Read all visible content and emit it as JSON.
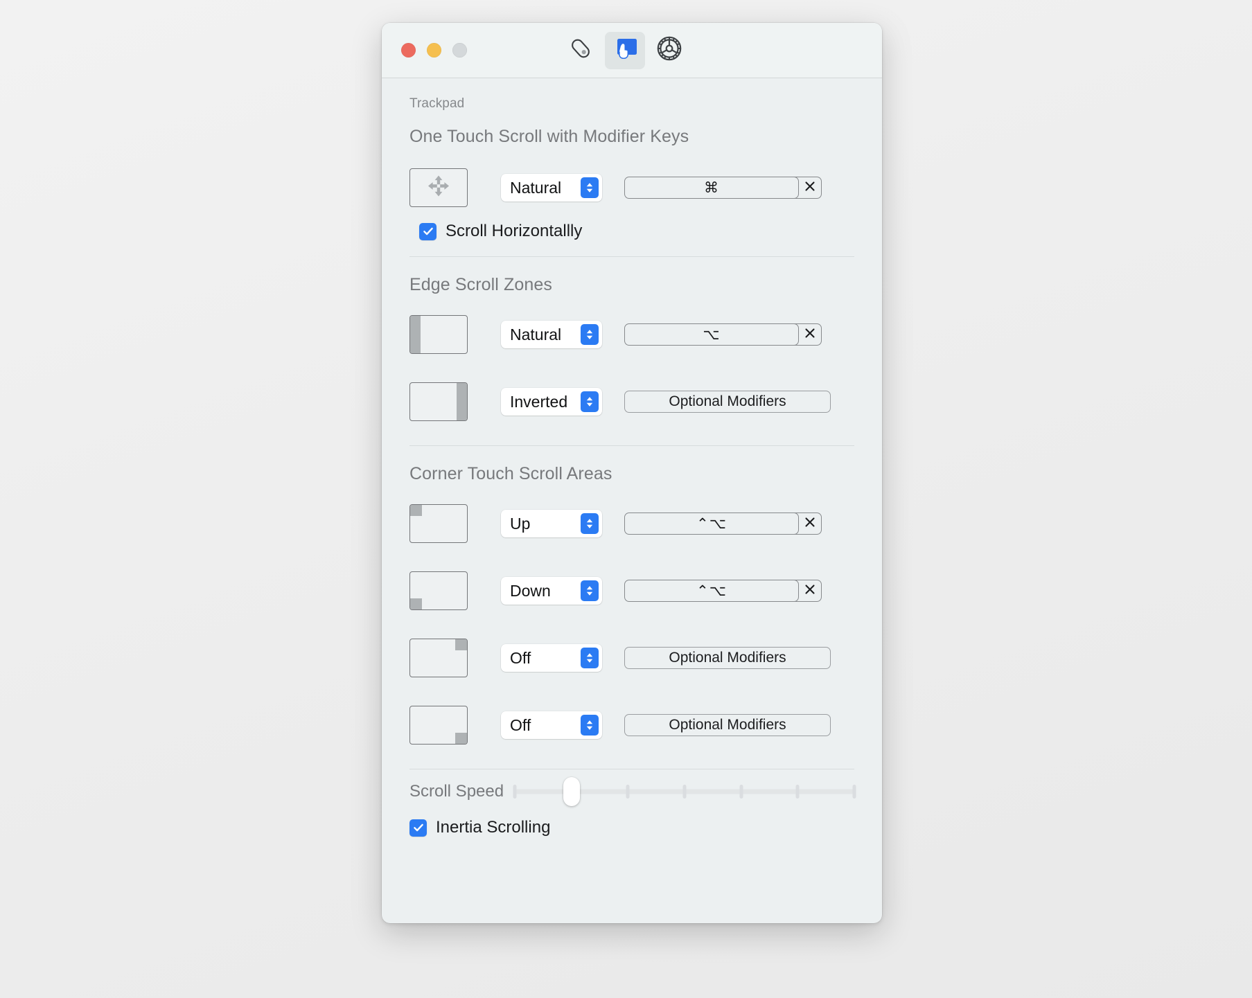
{
  "window": {
    "traffic_lights": [
      {
        "name": "close",
        "color": "#ec6a5e"
      },
      {
        "name": "minimize",
        "color": "#f5bf4f"
      },
      {
        "name": "zoom",
        "color": "#d4d8da"
      }
    ],
    "toolbar": [
      {
        "icon": "mouse-icon",
        "selected": false
      },
      {
        "icon": "trackpad-icon",
        "selected": true
      },
      {
        "icon": "gear-icon",
        "selected": false
      }
    ]
  },
  "pane": {
    "app_label": "Trackpad",
    "sections": [
      {
        "title": "One Touch Scroll with Modifier Keys",
        "rows": [
          {
            "pad": "move",
            "direction": "Natural",
            "modifier": "⌘",
            "has_clear": true,
            "optional_label": ""
          }
        ],
        "checkbox": {
          "label": "Scroll Horizontallly",
          "checked": true
        }
      },
      {
        "title": "Edge Scroll Zones",
        "rows": [
          {
            "pad": "left",
            "direction": "Natural",
            "modifier": "⌥",
            "has_clear": true,
            "optional_label": ""
          },
          {
            "pad": "right",
            "direction": "Inverted",
            "modifier": "",
            "has_clear": false,
            "optional_label": "Optional Modifiers"
          }
        ]
      },
      {
        "title": "Corner Touch Scroll Areas",
        "rows": [
          {
            "pad": "top-left",
            "direction": "Up",
            "modifier": "⌃⌥",
            "has_clear": true,
            "optional_label": ""
          },
          {
            "pad": "bottom-left",
            "direction": "Down",
            "modifier": "⌃⌥",
            "has_clear": true,
            "optional_label": ""
          },
          {
            "pad": "top-right",
            "direction": "Off",
            "modifier": "",
            "has_clear": false,
            "optional_label": "Optional Modifiers"
          },
          {
            "pad": "bottom-right",
            "direction": "Off",
            "modifier": "",
            "has_clear": false,
            "optional_label": "Optional Modifiers"
          }
        ]
      }
    ],
    "scroll_speed": {
      "label": "Scroll Speed",
      "value": 1,
      "min": 0,
      "max": 6,
      "ticks": 7
    },
    "inertia": {
      "label": "Inertia Scrolling",
      "checked": true
    }
  },
  "colors": {
    "accent": "#2b7bf3",
    "window_bg": "#ecf0f1",
    "titlebar_bg": "#eff3f3",
    "section_title": "#77797c",
    "text": "#1a1b1d"
  }
}
